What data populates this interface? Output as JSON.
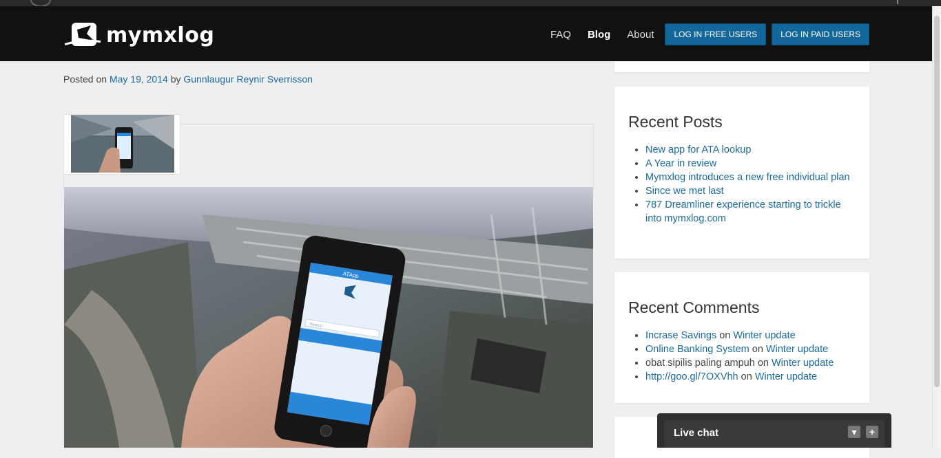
{
  "brand": {
    "name": "mymxlog"
  },
  "nav": {
    "links": [
      "FAQ",
      "Blog",
      "About"
    ],
    "buttons": [
      "LOG IN FREE USERS",
      "LOG IN PAID USERS"
    ]
  },
  "post": {
    "meta_prefix": "Posted on",
    "date": "May 19, 2014",
    "by": "by",
    "author": "Gunnlaugur Reynir Sverrisson"
  },
  "phone_screen": {
    "app_title": "ATApp",
    "search_placeholder": "Search"
  },
  "recent_posts": {
    "title": "Recent Posts",
    "items": [
      "New app for ATA lookup",
      "A Year in review",
      "Mymxlog introduces a new free individual plan",
      "Since we met last",
      "787 Dreamliner experience starting to trickle into mymxlog.com"
    ]
  },
  "recent_comments": {
    "title": "Recent Comments",
    "on": "on",
    "items": [
      {
        "author": "Incrase Savings",
        "author_link": true,
        "post": "Winter update"
      },
      {
        "author": "Online Banking System",
        "author_link": true,
        "post": "Winter update"
      },
      {
        "author": "obat sipilis paling ampuh",
        "author_link": false,
        "post": "Winter update"
      },
      {
        "author": "http://goo.gl/7OXVhh",
        "author_link": true,
        "post": "Winter update"
      }
    ]
  },
  "live_chat": {
    "title": "Live chat"
  },
  "colors": {
    "link": "#1a6aa0",
    "header_bg": "#111111",
    "button_bg": "#13679a"
  }
}
